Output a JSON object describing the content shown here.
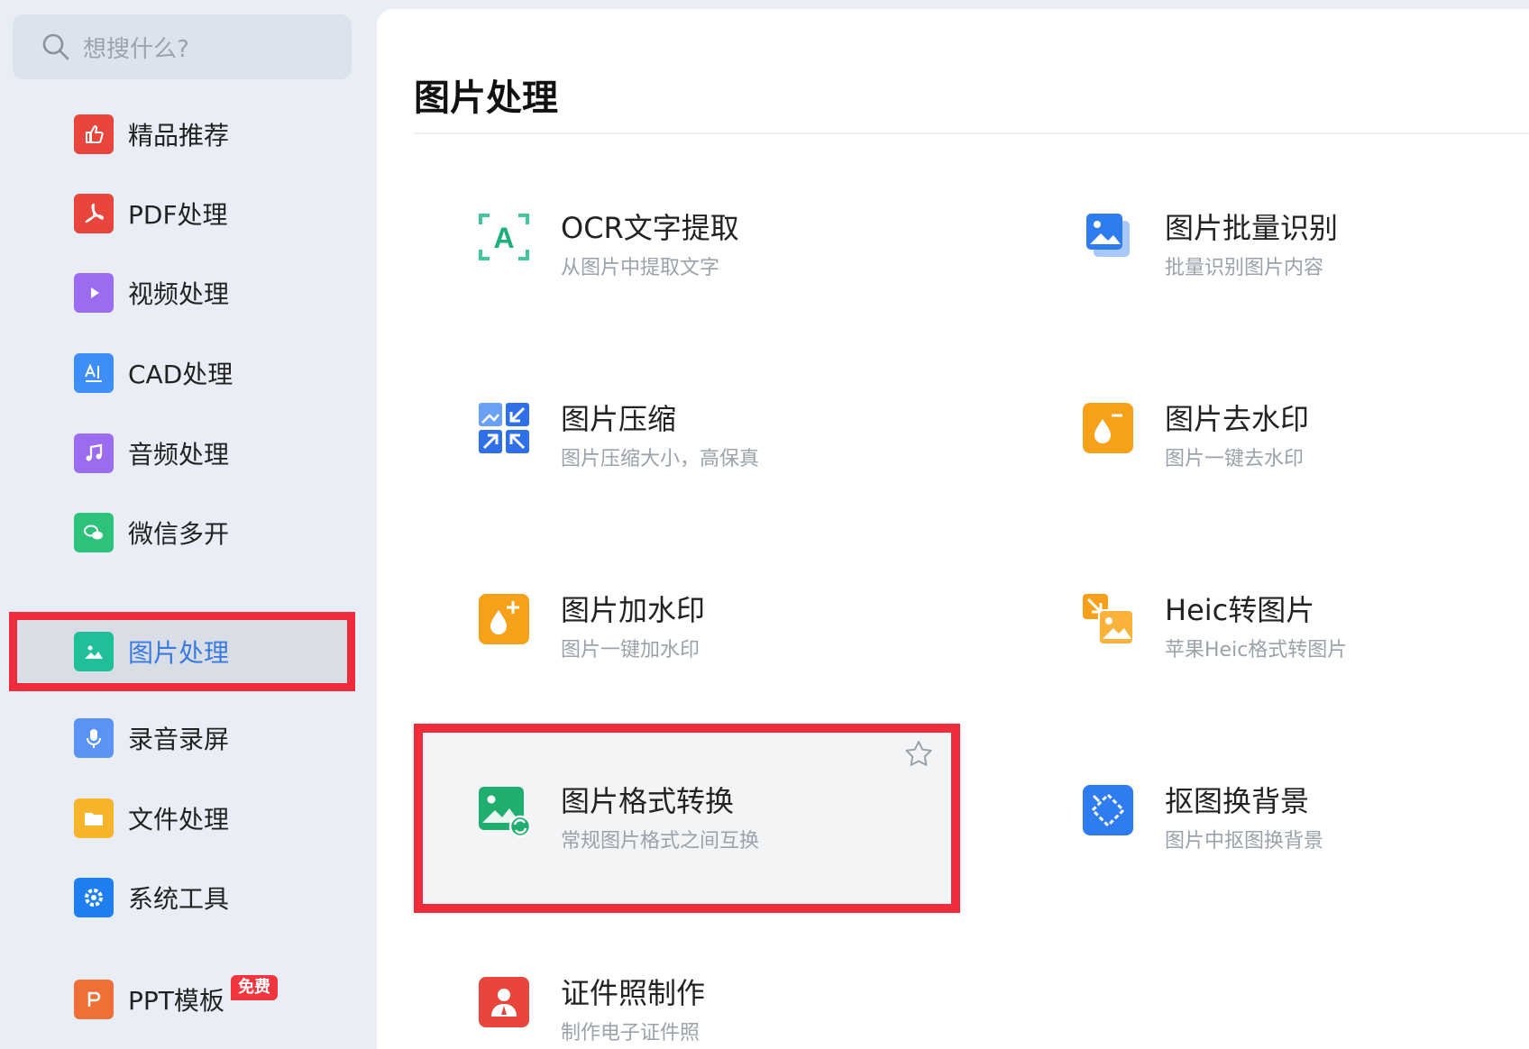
{
  "search": {
    "placeholder": "想搜什么?"
  },
  "sidebar": {
    "items": [
      {
        "label": "精品推荐",
        "color": "#e8453c"
      },
      {
        "label": "PDF处理",
        "color": "#e8453c"
      },
      {
        "label": "视频处理",
        "color": "#9c6cf0"
      },
      {
        "label": "CAD处理",
        "color": "#3d8ff5"
      },
      {
        "label": "音频处理",
        "color": "#9c6cf0"
      },
      {
        "label": "微信多开",
        "color": "#2dc27a"
      },
      {
        "label": "图片处理",
        "color": "#1fbf9a",
        "active": true
      },
      {
        "label": "录音录屏",
        "color": "#5b93f5"
      },
      {
        "label": "文件处理",
        "color": "#f6b42b"
      },
      {
        "label": "系统工具",
        "color": "#1f7ff0"
      },
      {
        "label": "PPT模板",
        "color": "#f06f36",
        "badge": "免费"
      }
    ]
  },
  "main": {
    "title": "图片处理",
    "tools": [
      {
        "title": "OCR文字提取",
        "desc": "从图片中提取文字",
        "icon": "ocr-icon"
      },
      {
        "title": "图片批量识别",
        "desc": "批量识别图片内容",
        "icon": "batch-image-icon"
      },
      {
        "title": "图片压缩",
        "desc": "图片压缩大小，高保真",
        "icon": "compress-icon"
      },
      {
        "title": "图片去水印",
        "desc": "图片一键去水印",
        "icon": "remove-watermark-icon"
      },
      {
        "title": "图片加水印",
        "desc": "图片一键加水印",
        "icon": "add-watermark-icon"
      },
      {
        "title": "Heic转图片",
        "desc": "苹果Heic格式转图片",
        "icon": "heic-convert-icon"
      },
      {
        "title": "图片格式转换",
        "desc": "常规图片格式之间互换",
        "icon": "format-convert-icon"
      },
      {
        "title": "抠图换背景",
        "desc": "图片中抠图换背景",
        "icon": "cutout-icon"
      },
      {
        "title": "证件照制作",
        "desc": "制作电子证件照",
        "icon": "id-photo-icon"
      }
    ]
  },
  "colors": {
    "accent": "#3a7be0",
    "highlight": "#ee2d3c"
  }
}
